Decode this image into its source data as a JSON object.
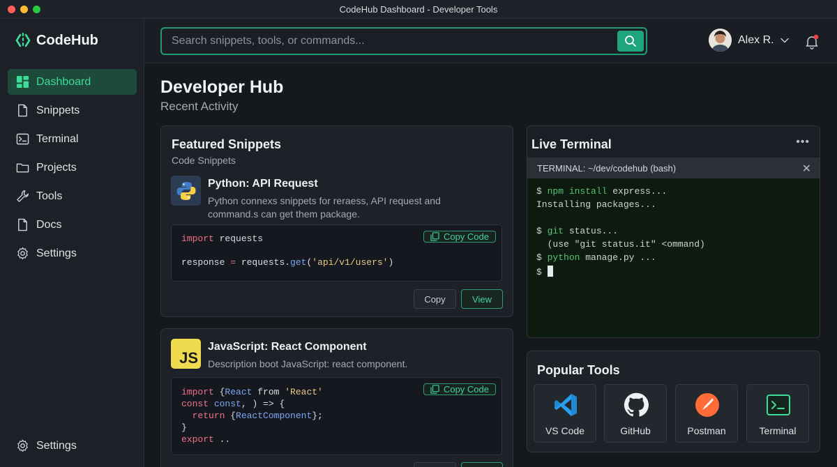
{
  "window": {
    "title": "CodeHub Dashboard - Developer Tools"
  },
  "brand": {
    "name": "CodeHub"
  },
  "sidebar": {
    "items": [
      {
        "label": "Dashboard",
        "icon": "dashboard-icon",
        "active": true
      },
      {
        "label": "Snippets",
        "icon": "file-icon"
      },
      {
        "label": "Terminal",
        "icon": "terminal-icon"
      },
      {
        "label": "Projects",
        "icon": "folder-icon"
      },
      {
        "label": "Tools",
        "icon": "wrench-icon"
      },
      {
        "label": "Docs",
        "icon": "document-icon"
      },
      {
        "label": "Settings",
        "icon": "gear-icon"
      }
    ],
    "bottom": {
      "label": "Settings",
      "icon": "gear-icon"
    }
  },
  "search": {
    "placeholder": "Search snippets, tools, or commands..."
  },
  "user": {
    "name": "Alex R."
  },
  "page": {
    "title": "Developer Hub",
    "subtitle": "Recent Activity"
  },
  "featured": {
    "title": "Featured Snippets",
    "subtitle": "Code Snippets",
    "snippets": [
      {
        "title": "Python: API Request",
        "description": "Python connexs snippets for reraess, API request and command.s can get them package.",
        "copy_code_label": "Copy Code",
        "copy_label": "Copy",
        "view_label": "View",
        "code": [
          {
            "kw": "import",
            "rest": " requests"
          },
          {
            "kw": "",
            "rest": ""
          },
          {
            "pre": "response ",
            "op": "=",
            "mid": " requests.",
            "fn": "get",
            "open": "(",
            "str": "'api/v1/users'",
            "close": ")"
          }
        ]
      },
      {
        "title": "JavaScript: React Component",
        "description": "Description boot JavaScript: react component.",
        "icon_text": "JS",
        "copy_code_label": "Copy Code",
        "code": [
          {
            "kw": "import",
            "a": " {",
            "fn": "React",
            "b": " from ",
            "str": "'React'"
          },
          {
            "kw": "const",
            "a": " ",
            "fn": "const",
            "b": ", ) => {"
          },
          {
            "kw": "  return",
            "a": " {",
            "fn": "ReactComponent",
            "b": "};"
          },
          {
            "plain": "}"
          },
          {
            "kw": "export",
            "a": " .."
          }
        ]
      }
    ]
  },
  "terminal": {
    "title": "Live Terminal",
    "bar_label": "TERMINAL: ~/dev/codehub (bash)",
    "lines": [
      {
        "prompt": "$ ",
        "cmd": "npm install",
        "rest": " express..."
      },
      {
        "prompt": "",
        "cmd": "",
        "rest": "Installing packages..."
      },
      {
        "prompt": "",
        "cmd": "",
        "rest": ""
      },
      {
        "prompt": "$ ",
        "cmd": "git",
        "rest": " status..."
      },
      {
        "prompt": "",
        "cmd": "",
        "rest": "  (use \"git status.it\" <ommand)"
      },
      {
        "prompt": "$ ",
        "cmd": "python",
        "rest": " manage.py ..."
      },
      {
        "prompt": "$ ",
        "cmd": "",
        "rest": "",
        "cursor": true
      }
    ]
  },
  "tools": {
    "title": "Popular Tools",
    "items": [
      {
        "label": "VS Code",
        "icon": "vscode-icon"
      },
      {
        "label": "GitHub",
        "icon": "github-icon"
      },
      {
        "label": "Postman",
        "icon": "postman-icon"
      },
      {
        "label": "Terminal",
        "icon": "terminal-icon"
      }
    ]
  },
  "colors": {
    "accent": "#1fa57c",
    "accent_text": "#3ddc97",
    "bg": "#15181d",
    "panel": "#1e2128",
    "terminal_bg": "#0d1a10"
  }
}
